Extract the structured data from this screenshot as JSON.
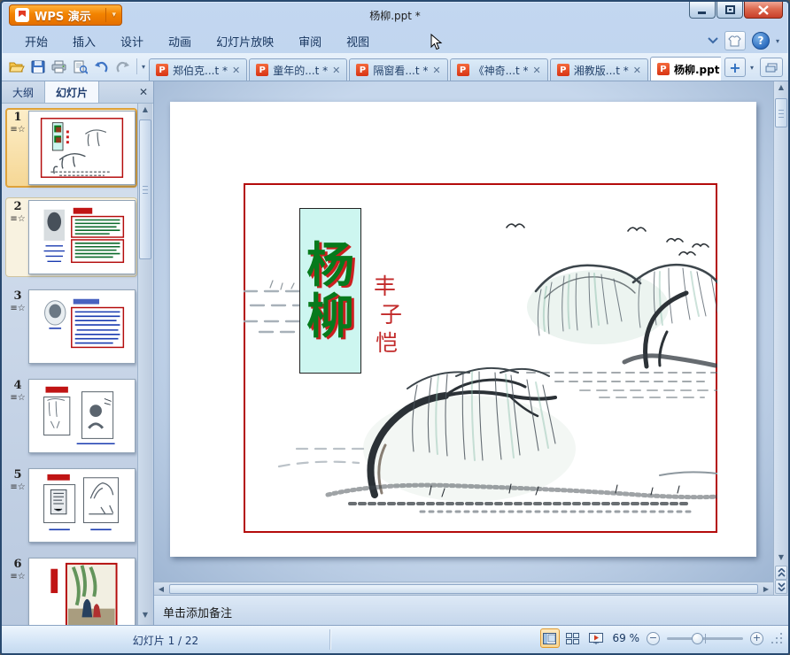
{
  "window": {
    "app_button_label": "WPS 演示",
    "title": "杨柳.ppt *"
  },
  "menu": {
    "items": [
      {
        "label": "开始"
      },
      {
        "label": "插入"
      },
      {
        "label": "设计"
      },
      {
        "label": "动画"
      },
      {
        "label": "幻灯片放映"
      },
      {
        "label": "审阅"
      },
      {
        "label": "视图"
      }
    ]
  },
  "doc_tabs": {
    "tabs": [
      {
        "label": "郑伯克...t *",
        "active": false
      },
      {
        "label": "童年的...t *",
        "active": false
      },
      {
        "label": "隔窗看...t *",
        "active": false
      },
      {
        "label": "《神奇...t *",
        "active": false
      },
      {
        "label": "湘教版...t *",
        "active": false
      },
      {
        "label": "杨柳.ppt *",
        "active": true
      }
    ],
    "new_tab_label": "+",
    "close_glyph": "✕",
    "ppt_icon_letter": "P"
  },
  "sidebar": {
    "tabs": [
      {
        "label": "大纲",
        "active": false
      },
      {
        "label": "幻灯片",
        "active": true
      }
    ],
    "close_glyph": "✕",
    "slides": [
      {
        "number": "1"
      },
      {
        "number": "2"
      },
      {
        "number": "3"
      },
      {
        "number": "4"
      },
      {
        "number": "5"
      },
      {
        "number": "6"
      }
    ],
    "animation_star_glyph": "☆"
  },
  "slide": {
    "title_line1": "杨",
    "title_line2": "柳",
    "author": [
      "丰",
      "子",
      "恺"
    ]
  },
  "notes": {
    "placeholder": "单击添加备注"
  },
  "status_bar": {
    "slide_counter": "幻灯片 1 / 22",
    "zoom_level": "69 %"
  },
  "icons": {
    "scroll_up": "▲",
    "scroll_down": "▼",
    "scroll_left": "◀",
    "scroll_right": "▶",
    "help": "?"
  },
  "colors": {
    "accent_orange": "#f38300",
    "slide_border_red": "#b40b0b",
    "title_green": "#067a1c",
    "title_red": "#cc2020",
    "title_box_cyan": "#cdf6f0",
    "close_button_red": "#c8402a"
  }
}
